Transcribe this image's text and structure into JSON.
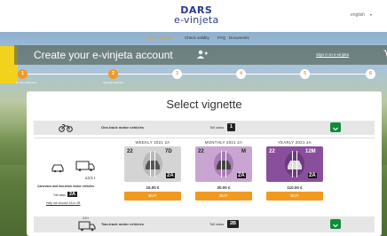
{
  "header": {
    "logo_top": "DARS",
    "logo_bottom": "e-vinjeta",
    "language": "english"
  },
  "nav": {
    "items": [
      "Buy e-vignette",
      "Check validity",
      "FAQ",
      "Documents"
    ]
  },
  "titlebar": {
    "title": "Create your e-vinjeta account",
    "sign_in": "Sign in to e-vinjeta"
  },
  "steps": [
    {
      "num": "1",
      "label": "E-mail verification"
    },
    {
      "num": "2",
      "label": "Vignette selection"
    },
    {
      "num": "3",
      "label": ""
    },
    {
      "num": "4",
      "label": ""
    },
    {
      "num": "5",
      "label": ""
    },
    {
      "num": "6",
      "label": ""
    }
  ],
  "main": {
    "title": "Select vignette",
    "categories": [
      {
        "label": "One-track motor vehicles",
        "toll_class_label": "Toll class",
        "toll_class": "1"
      },
      {
        "label": "Two-track motor vehicles",
        "toll_class_label": "Toll class",
        "toll_class": "2B"
      }
    ],
    "open_category": {
      "weight": "≤3,5 t",
      "desc": "Cars/vans and two-track motor vehicles",
      "toll_class_label": "Toll class",
      "toll_class": "2A",
      "help_link": "Help me choose 2A or 2B",
      "bottom_weight": "3,5 t"
    },
    "vignettes": [
      {
        "title": "WEEKLY 2021 2A",
        "year": "22",
        "period": "7D",
        "cls": "2A",
        "price": "15.00 €",
        "buy": "BUY",
        "color": "#d4d4d4"
      },
      {
        "title": "MONTHLY 2021 2A",
        "year": "22",
        "period": "M",
        "cls": "2A",
        "price": "30.00 €",
        "buy": "BUY",
        "color": "#c9a6d1"
      },
      {
        "title": "YEARLY 2021 2A",
        "year": "22",
        "period": "12M",
        "cls": "2A",
        "price": "110.00 €",
        "buy": "BUY",
        "color": "#8a4f9c"
      }
    ]
  },
  "colors": {
    "accent": "#f29a1f",
    "green": "#0f8a3e",
    "brand_blue": "#2a3b8c"
  }
}
